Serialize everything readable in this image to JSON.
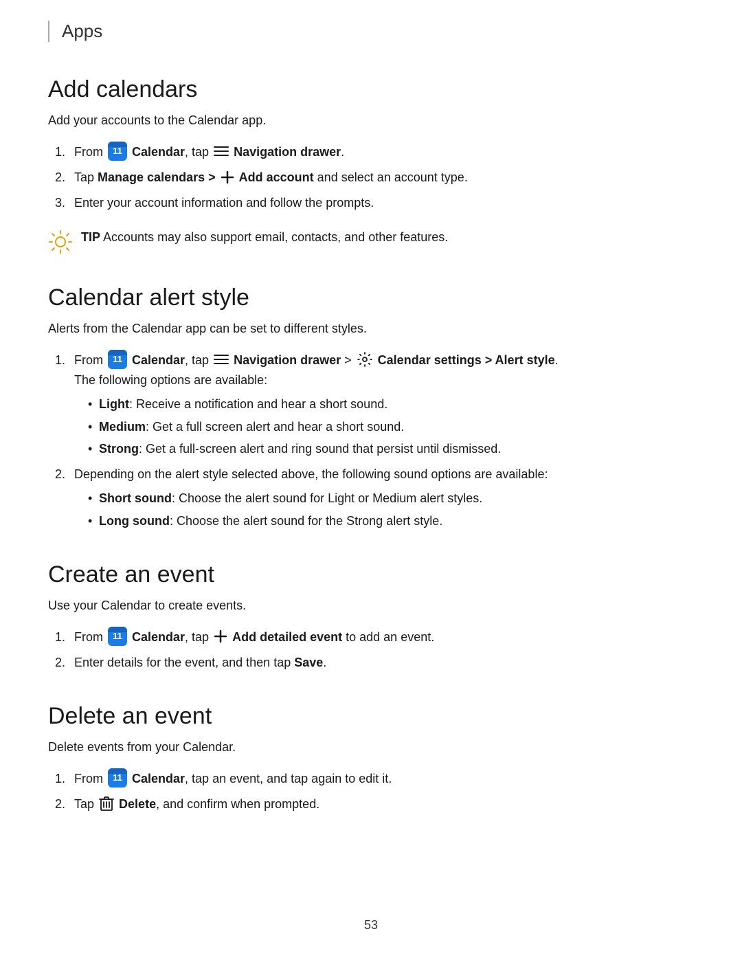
{
  "header": {
    "title": "Apps"
  },
  "sections": [
    {
      "id": "add-calendars",
      "heading": "Add calendars",
      "intro": "Add your accounts to the Calendar app.",
      "steps": [
        {
          "id": "step1",
          "parts": [
            {
              "type": "text",
              "value": "From "
            },
            {
              "type": "calendar-icon"
            },
            {
              "type": "bold",
              "value": " Calendar"
            },
            {
              "type": "text",
              "value": ", tap "
            },
            {
              "type": "nav-icon"
            },
            {
              "type": "bold",
              "value": " Navigation drawer"
            },
            {
              "type": "text",
              "value": "."
            }
          ]
        },
        {
          "id": "step2",
          "parts": [
            {
              "type": "text",
              "value": "Tap "
            },
            {
              "type": "bold",
              "value": "Manage calendars > "
            },
            {
              "type": "plus-icon"
            },
            {
              "type": "bold",
              "value": " Add account"
            },
            {
              "type": "text",
              "value": " and select an account type."
            }
          ]
        },
        {
          "id": "step3",
          "parts": [
            {
              "type": "text",
              "value": "Enter your account information and follow the prompts."
            }
          ]
        }
      ],
      "tip": "Accounts may also support email, contacts, and other features."
    },
    {
      "id": "calendar-alert-style",
      "heading": "Calendar alert style",
      "intro": "Alerts from the Calendar app can be set to different styles.",
      "steps": [
        {
          "id": "step1",
          "mainParts": [
            {
              "type": "text",
              "value": "From "
            },
            {
              "type": "calendar-icon"
            },
            {
              "type": "bold",
              "value": " Calendar"
            },
            {
              "type": "text",
              "value": ", tap "
            },
            {
              "type": "nav-icon"
            },
            {
              "type": "bold",
              "value": " Navigation drawer"
            },
            {
              "type": "text",
              "value": " > "
            },
            {
              "type": "settings-icon"
            },
            {
              "type": "bold",
              "value": " Calendar settings > Alert style"
            },
            {
              "type": "text",
              "value": "."
            }
          ],
          "subtext": "The following options are available:",
          "bullets": [
            {
              "bold": "Light",
              "text": ": Receive a notification and hear a short sound."
            },
            {
              "bold": "Medium",
              "text": ": Get a full screen alert and hear a short sound."
            },
            {
              "bold": "Strong",
              "text": ": Get a full-screen alert and ring sound that persist until dismissed."
            }
          ]
        },
        {
          "id": "step2",
          "mainParts": [
            {
              "type": "text",
              "value": "Depending on the alert style selected above, the following sound options are available:"
            }
          ],
          "bullets": [
            {
              "bold": "Short sound",
              "text": ": Choose the alert sound for Light or Medium alert styles."
            },
            {
              "bold": "Long sound",
              "text": ": Choose the alert sound for the Strong alert style."
            }
          ]
        }
      ]
    },
    {
      "id": "create-event",
      "heading": "Create an event",
      "intro": "Use your Calendar to create events.",
      "steps": [
        {
          "id": "step1",
          "parts": [
            {
              "type": "text",
              "value": "From "
            },
            {
              "type": "calendar-icon"
            },
            {
              "type": "bold",
              "value": " Calendar"
            },
            {
              "type": "text",
              "value": ", tap "
            },
            {
              "type": "plus-icon"
            },
            {
              "type": "bold",
              "value": " Add detailed event"
            },
            {
              "type": "text",
              "value": " to add an event."
            }
          ]
        },
        {
          "id": "step2",
          "parts": [
            {
              "type": "text",
              "value": "Enter details for the event, and then tap "
            },
            {
              "type": "bold",
              "value": "Save"
            },
            {
              "type": "text",
              "value": "."
            }
          ]
        }
      ]
    },
    {
      "id": "delete-event",
      "heading": "Delete an event",
      "intro": "Delete events from your Calendar.",
      "steps": [
        {
          "id": "step1",
          "parts": [
            {
              "type": "text",
              "value": "From "
            },
            {
              "type": "calendar-icon"
            },
            {
              "type": "bold",
              "value": " Calendar"
            },
            {
              "type": "text",
              "value": ", tap an event, and tap again to edit it."
            }
          ]
        },
        {
          "id": "step2",
          "parts": [
            {
              "type": "text",
              "value": "Tap "
            },
            {
              "type": "trash-icon"
            },
            {
              "type": "bold",
              "value": " Delete"
            },
            {
              "type": "text",
              "value": ", and confirm when prompted."
            }
          ]
        }
      ]
    }
  ],
  "page_number": "53",
  "tip_label": "TIP"
}
